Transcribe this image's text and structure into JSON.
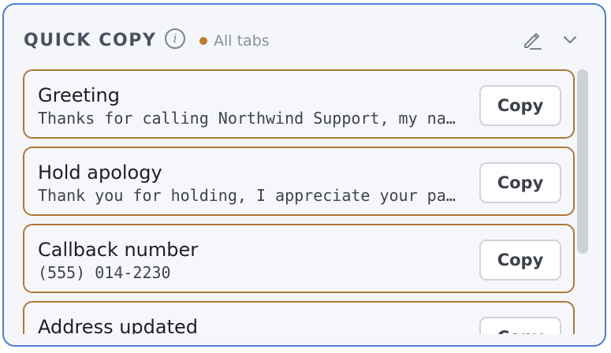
{
  "header": {
    "title": "QUICK COPY",
    "info_icon": "info-icon",
    "info_glyph": "i",
    "scope_label": "All tabs",
    "scope_color": "#c07c2b",
    "edit_icon": "pencil-icon",
    "collapse_icon": "chevron-down-icon"
  },
  "items": [
    {
      "title": "Greeting",
      "snippet": "Thanks for calling Northwind Support, my name is",
      "button": "Copy"
    },
    {
      "title": "Hold apology",
      "snippet": "Thank you for holding, I appreciate your patience",
      "button": "Copy"
    },
    {
      "title": "Callback number",
      "snippet": "(555) 014-2230",
      "button": "Copy"
    },
    {
      "title": "Address updated",
      "snippet": "",
      "button": "Copy"
    }
  ],
  "colors": {
    "panel_border": "#4f7fd1",
    "item_border": "#b07837",
    "panel_background": "#f4f6fa"
  }
}
